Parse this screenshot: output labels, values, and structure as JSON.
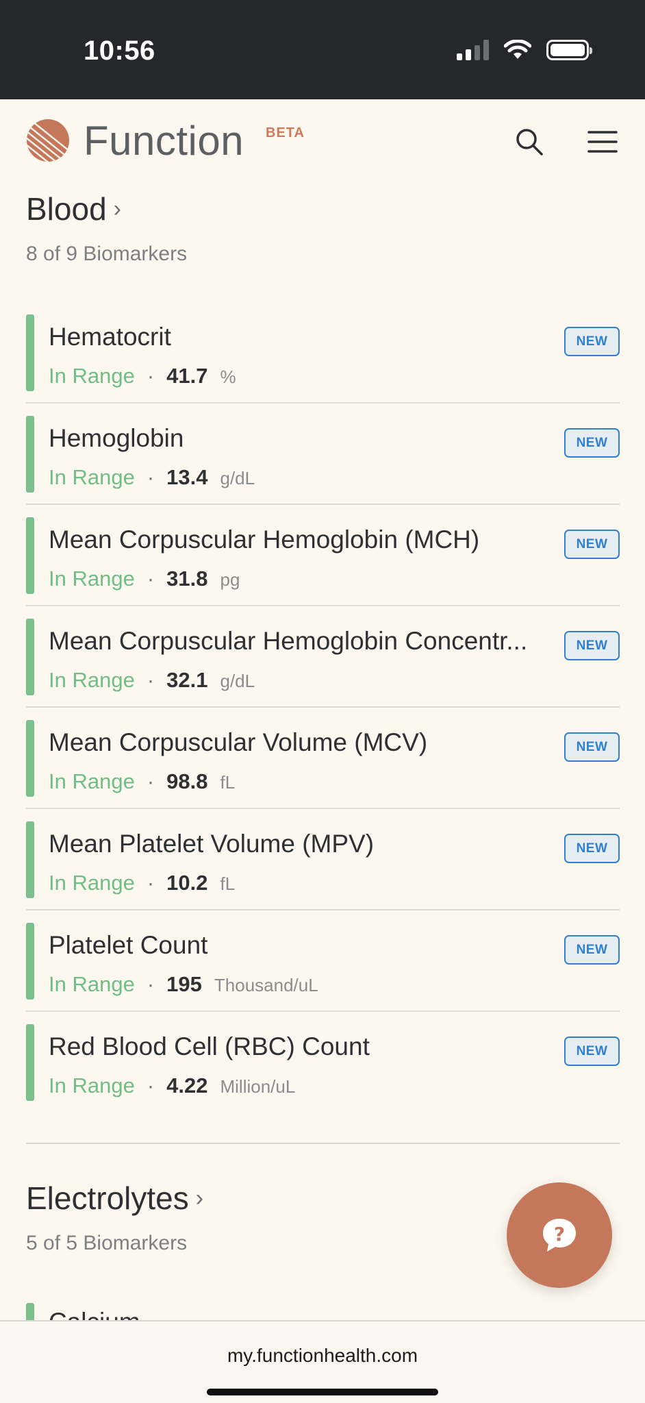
{
  "status_bar": {
    "time": "10:56"
  },
  "header": {
    "brand": "Function",
    "beta": "BETA"
  },
  "sections": [
    {
      "title": "Blood",
      "subtitle": "8 of 9 Biomarkers",
      "items": [
        {
          "name": "Hematocrit",
          "status": "In Range",
          "value": "41.7",
          "unit": "%",
          "badge": "NEW"
        },
        {
          "name": "Hemoglobin",
          "status": "In Range",
          "value": "13.4",
          "unit": "g/dL",
          "badge": "NEW"
        },
        {
          "name": "Mean Corpuscular Hemoglobin (MCH)",
          "status": "In Range",
          "value": "31.8",
          "unit": "pg",
          "badge": "NEW"
        },
        {
          "name": "Mean Corpuscular Hemoglobin Concentr...",
          "status": "In Range",
          "value": "32.1",
          "unit": "g/dL",
          "badge": "NEW"
        },
        {
          "name": "Mean Corpuscular Volume (MCV)",
          "status": "In Range",
          "value": "98.8",
          "unit": "fL",
          "badge": "NEW"
        },
        {
          "name": "Mean Platelet Volume (MPV)",
          "status": "In Range",
          "value": "10.2",
          "unit": "fL",
          "badge": "NEW"
        },
        {
          "name": "Platelet Count",
          "status": "In Range",
          "value": "195",
          "unit": "Thousand/uL",
          "badge": "NEW"
        },
        {
          "name": "Red Blood Cell (RBC) Count",
          "status": "In Range",
          "value": "4.22",
          "unit": "Million/uL",
          "badge": "NEW"
        }
      ]
    },
    {
      "title": "Electrolytes",
      "subtitle": "5 of 5 Biomarkers",
      "items": [
        {
          "name": "Calcium"
        }
      ]
    }
  ],
  "separator": "·",
  "browser": {
    "url": "my.functionhealth.com"
  },
  "icons": {
    "logo": "function-logo-icon",
    "search": "search-icon",
    "menu": "hamburger-menu-icon",
    "help": "help-chat-icon",
    "chevron": "chevron-right-icon"
  },
  "colors": {
    "background": "#fcf8ef",
    "brand": "#c4775b",
    "in_range": "#72bc86",
    "badge": "#2f7fd3"
  }
}
